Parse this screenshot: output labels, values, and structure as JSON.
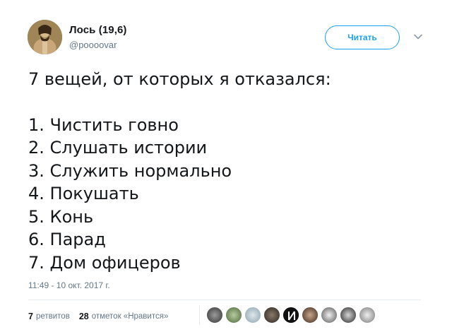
{
  "user": {
    "name": "Лось (19,6)",
    "handle": "@poooovar",
    "avatar_icon": "user-avatar"
  },
  "actions": {
    "follow_label": "Читать",
    "more_icon": "chevron-down-icon"
  },
  "tweet": {
    "heading": "7 вещей, от которых я отказался:",
    "items": [
      "1. Чистить говно",
      "2. Слушать истории",
      "3. Служить нормально",
      "4. Покушать",
      "5. Конь",
      "6. Парад",
      "7. Дом офицеров"
    ],
    "timestamp": "11:49 - 10 окт. 2017 г."
  },
  "stats": {
    "retweets_count": "7",
    "retweets_label": "ретвитов",
    "likes_count": "28",
    "likes_label": "отметок «Нравится»"
  },
  "colors": {
    "accent": "#1da1f2",
    "secondary_text": "#657786",
    "primary_text": "#14171a"
  }
}
